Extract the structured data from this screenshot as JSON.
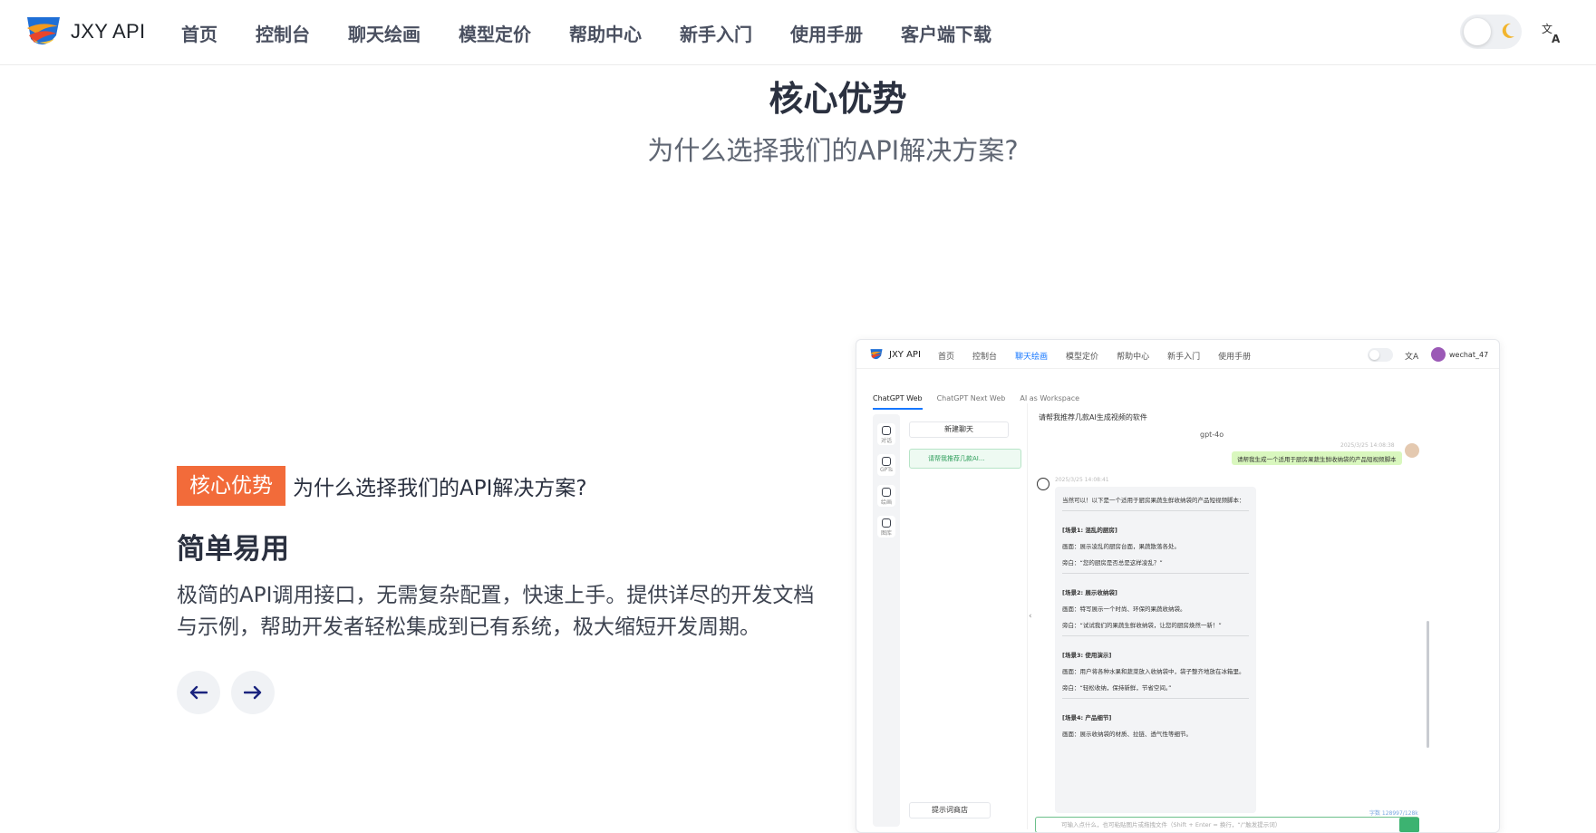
{
  "header": {
    "brand": "JXY API",
    "nav": [
      {
        "label": "首页",
        "active": true
      },
      {
        "label": "控制台",
        "active": false
      },
      {
        "label": "聊天绘画",
        "active": false
      },
      {
        "label": "模型定价",
        "active": false
      },
      {
        "label": "帮助中心",
        "active": false
      },
      {
        "label": "新手入门",
        "active": false
      },
      {
        "label": "使用手册",
        "active": false
      },
      {
        "label": "客户端下载",
        "active": false
      }
    ],
    "theme_icon": "moon-icon",
    "language_icon": "translate-icon",
    "accent_color": "#1677ff"
  },
  "hero": {
    "title": "核心优势",
    "subtitle": "为什么选择我们的API解决方案?"
  },
  "feature": {
    "tag": "核心优势",
    "tag_color": "#f26b3a",
    "tag_text": "为什么选择我们的API解决方案?",
    "title": "简单易用",
    "description": "极简的API调用接口，无需复杂配置，快速上手。提供详尽的开发文档与示例，帮助开发者轻松集成到已有系统，极大缩短开发周期。",
    "prev_icon": "arrow-left-icon",
    "next_icon": "arrow-right-icon"
  },
  "preview": {
    "brand": "JXY API",
    "nav": [
      "首页",
      "控制台",
      "聊天绘画",
      "模型定价",
      "帮助中心",
      "新手入门",
      "使用手册"
    ],
    "active_nav": "聊天绘画",
    "user": "wechat_47",
    "tabs": [
      "ChatGPT Web",
      "ChatGPT Next Web",
      "AI as Workspace"
    ],
    "rail": [
      "对话",
      "GPTs",
      "绘画",
      "图库"
    ],
    "new_chat": "新建聊天",
    "chat_item": "请帮我推荐几款AI...",
    "prompt_shop": "提示词商店",
    "chat_title": "请帮我推荐几款AI生成视频的软件",
    "model": "gpt-4o",
    "user_time": "2025/3/25 14:08:38",
    "user_message": "请帮我生成一个适用于厨房果蔬生鲜收纳袋的产品短视频脚本",
    "bot_time": "2025/3/25 14:08:41",
    "bot_intro": "当然可以！以下是一个适用于厨房果蔬生鲜收纳袋的产品短视频脚本：",
    "scenes": [
      {
        "title": "[场景1: 混乱的厨房]",
        "visual": "画面：展示凌乱的厨房台面，果蔬散落各处。",
        "voice": "旁白：“您的厨房是否总是这样凌乱？”"
      },
      {
        "title": "[场景2: 展示收纳袋]",
        "visual": "画面：特写展示一个时尚、环保的果蔬收纳袋。",
        "voice": "旁白：“试试我们的果蔬生鲜收纳袋，让您的厨房焕然一新！”"
      },
      {
        "title": "[场景3: 使用演示]",
        "visual": "画面：用户将各种水果和蔬菜放入收纳袋中，袋子整齐地放在冰箱里。",
        "voice": "旁白：“轻松收纳，保持新鲜，节省空间。”"
      },
      {
        "title": "[场景4: 产品细节]",
        "visual": "画面：展示收纳袋的材质、拉链、透气性等细节。",
        "voice": ""
      }
    ],
    "tokens": "字数 128997/128k",
    "input_placeholder": "可输入点什么，也可粘贴图片或拖拽文件（Shift + Enter = 换行，“/”触发提示词）"
  }
}
